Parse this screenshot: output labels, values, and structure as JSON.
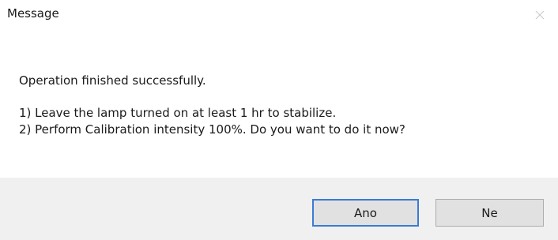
{
  "window": {
    "title": "Message",
    "close_icon": "close-icon"
  },
  "message": {
    "main_instruction": "Operation finished successfully.",
    "lines": [
      "1) Leave the lamp turned on at least 1 hr to stabilize.",
      "2) Perform Calibration intensity 100%. Do you want to do it now?"
    ]
  },
  "buttons": {
    "yes_label": "Ano",
    "no_label": "Ne"
  },
  "colors": {
    "footer_background": "#f0f0f0",
    "default_button_border": "#3a7bd5",
    "button_background": "#e1e1e1"
  }
}
